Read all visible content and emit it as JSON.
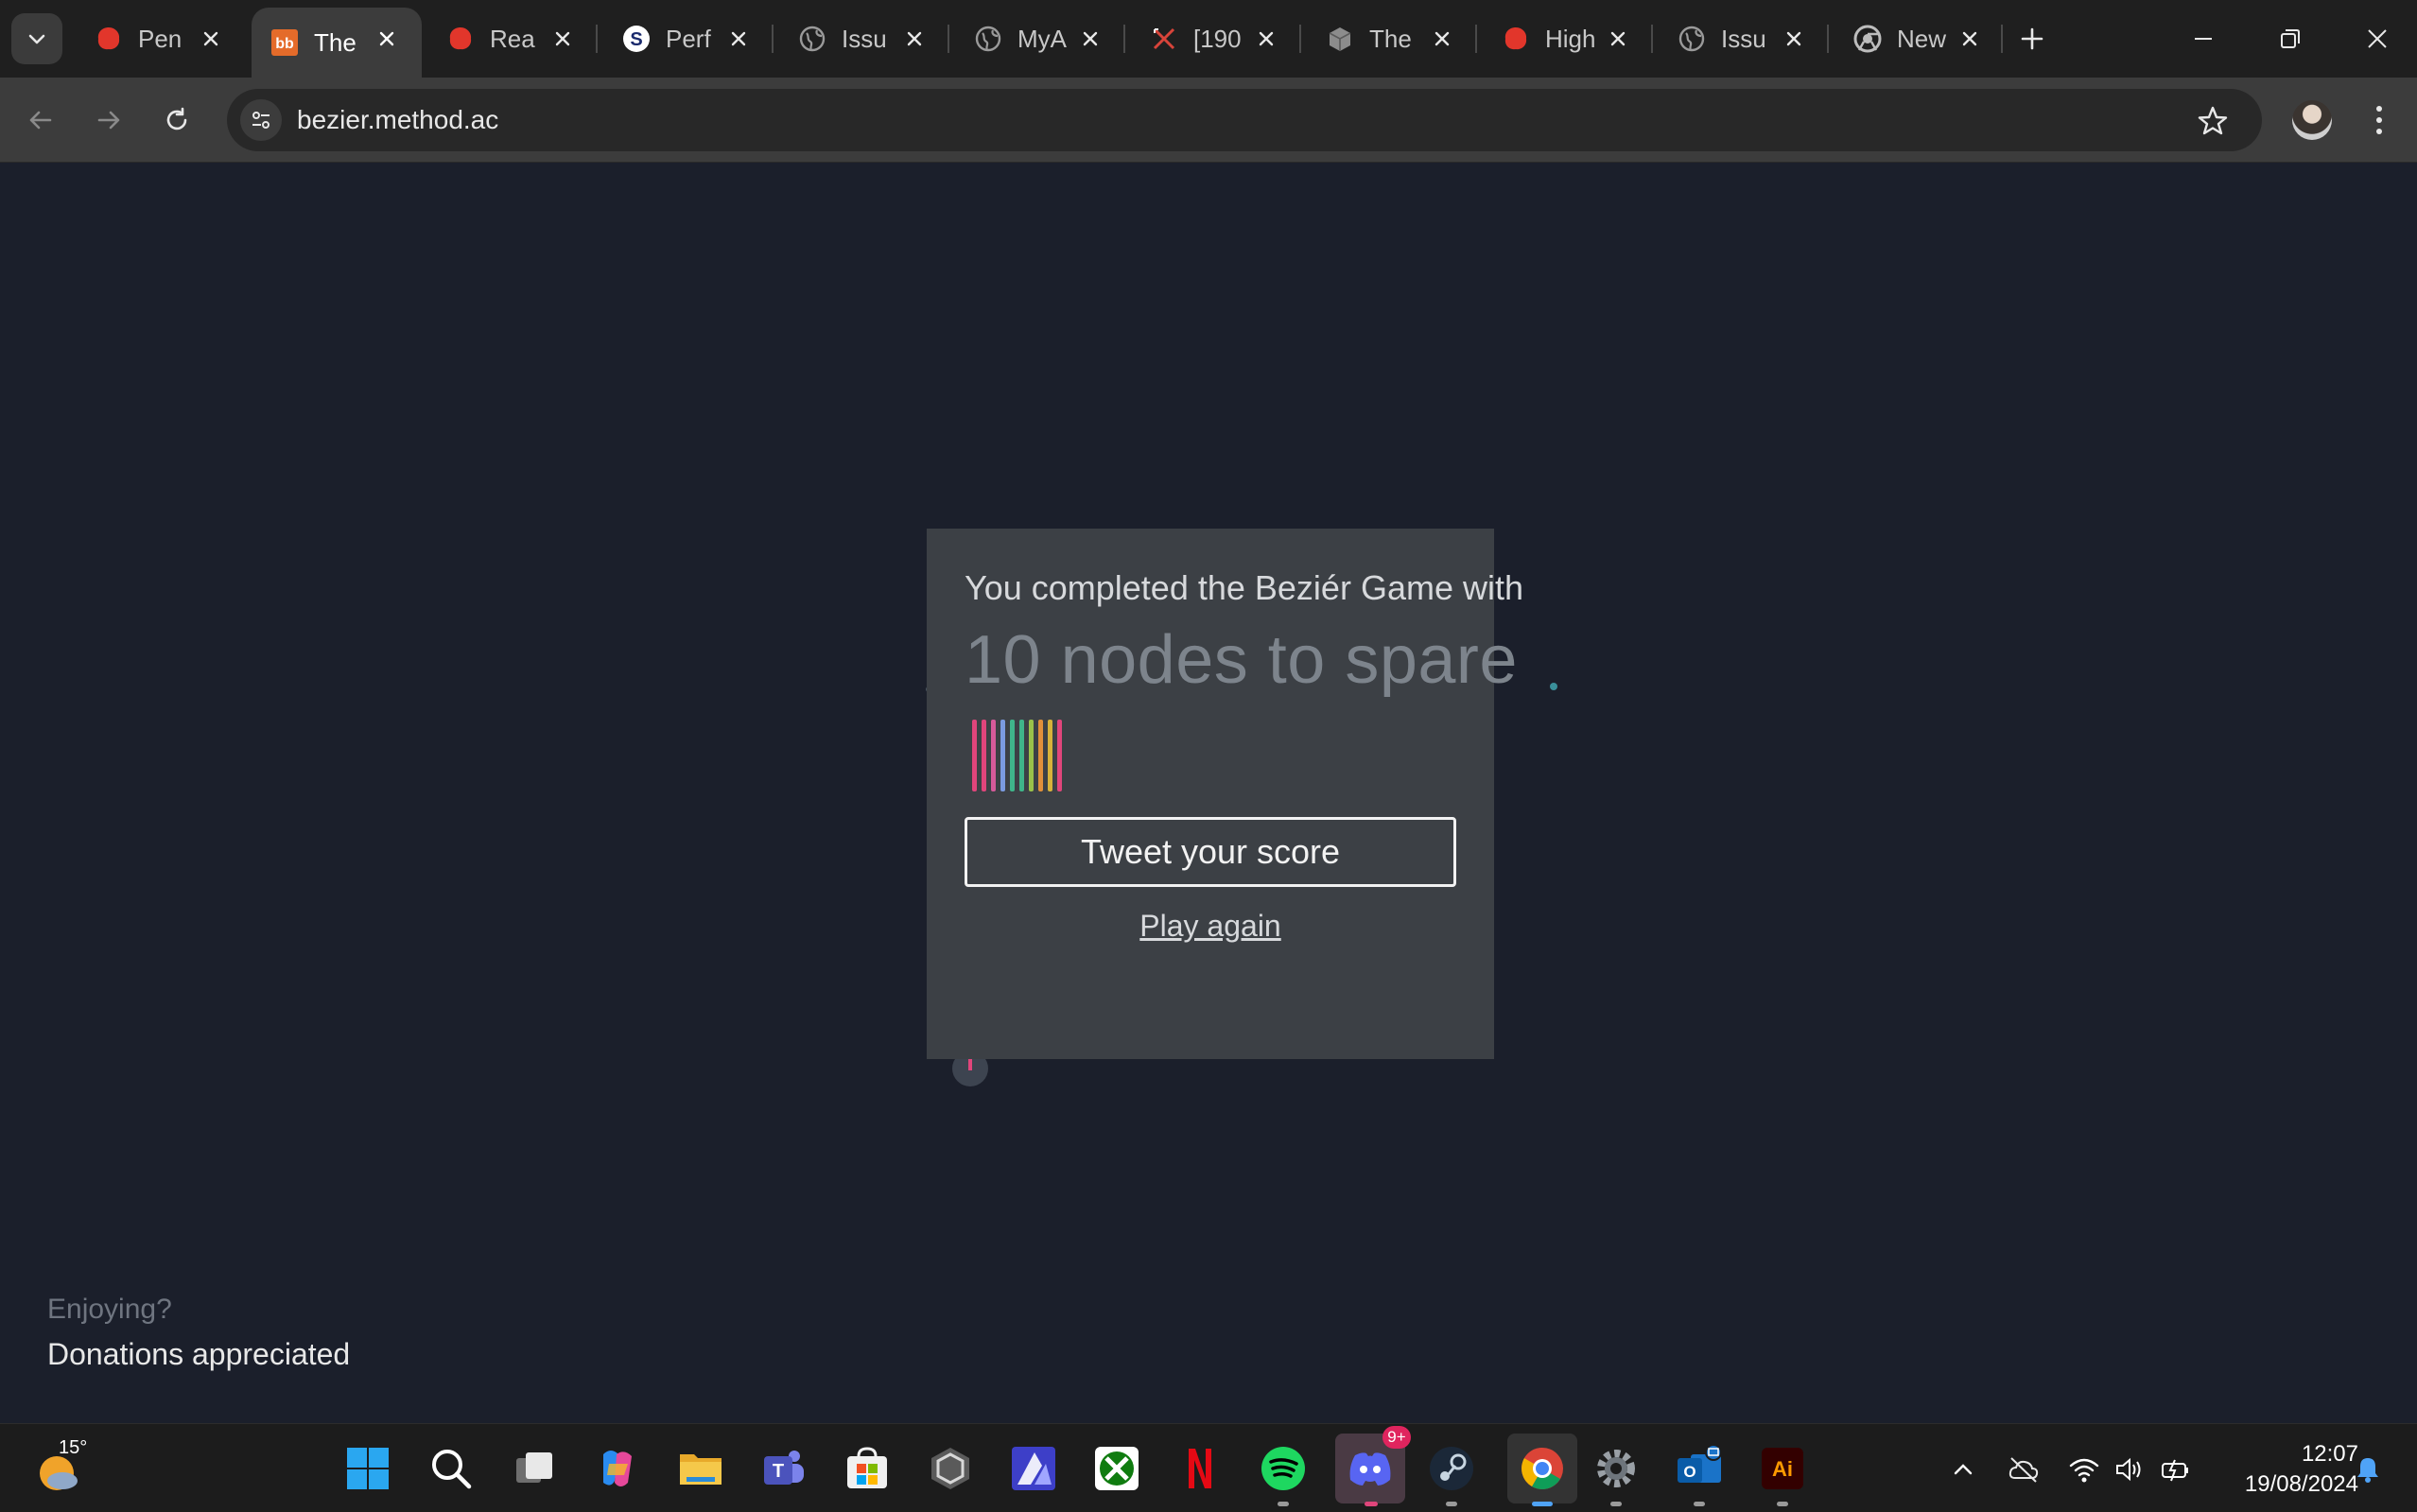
{
  "browser": {
    "tabs": [
      {
        "title": "Pen",
        "icon": "red-blob-icon",
        "active": false
      },
      {
        "title": "The",
        "icon": "bb-logo-icon",
        "active": true
      },
      {
        "title": "Rea",
        "icon": "red-blob-icon",
        "active": false
      },
      {
        "title": "Perf",
        "icon": "s-logo-icon",
        "active": false
      },
      {
        "title": "Issu",
        "icon": "globe-icon",
        "active": false
      },
      {
        "title": "MyA",
        "icon": "globe-icon",
        "active": false
      },
      {
        "title": "[190",
        "icon": "crossed-swords-icon",
        "active": false
      },
      {
        "title": "The",
        "icon": "cube-icon",
        "active": false
      },
      {
        "title": "High",
        "icon": "red-blob-icon",
        "active": false
      },
      {
        "title": "Issu",
        "icon": "globe-icon",
        "active": false
      },
      {
        "title": "New",
        "icon": "chrome-icon",
        "active": false
      }
    ],
    "url": "bezier.method.ac"
  },
  "game": {
    "heading": "You completed the Beziér Game with",
    "score": "10 nodes to spare",
    "tweet_label": "Tweet your score",
    "play_again_label": "Play again",
    "spare_nodes": 10,
    "bar_colors": [
      "#e0457b",
      "#e0457b",
      "#d65a9a",
      "#7b9be0",
      "#3fb58a",
      "#3fb58a",
      "#9ac24a",
      "#e08f3a",
      "#d6b23a",
      "#e0457b"
    ]
  },
  "footer": {
    "question": "Enjoying?",
    "link": "Donations appreciated"
  },
  "taskbar": {
    "weather_temp": "15°",
    "discord_badge": "9+",
    "time": "12:07",
    "date": "19/08/2024",
    "apps": [
      "start-icon",
      "search-icon",
      "task-view-icon",
      "copilot-icon",
      "file-explorer-icon",
      "teams-icon",
      "store-icon",
      "unity-icon",
      "affinity-icon",
      "xbox-icon",
      "netflix-icon",
      "spotify-icon",
      "discord-icon",
      "steam-icon",
      "chrome-icon",
      "settings-icon",
      "outlook-icon",
      "illustrator-icon"
    ]
  }
}
